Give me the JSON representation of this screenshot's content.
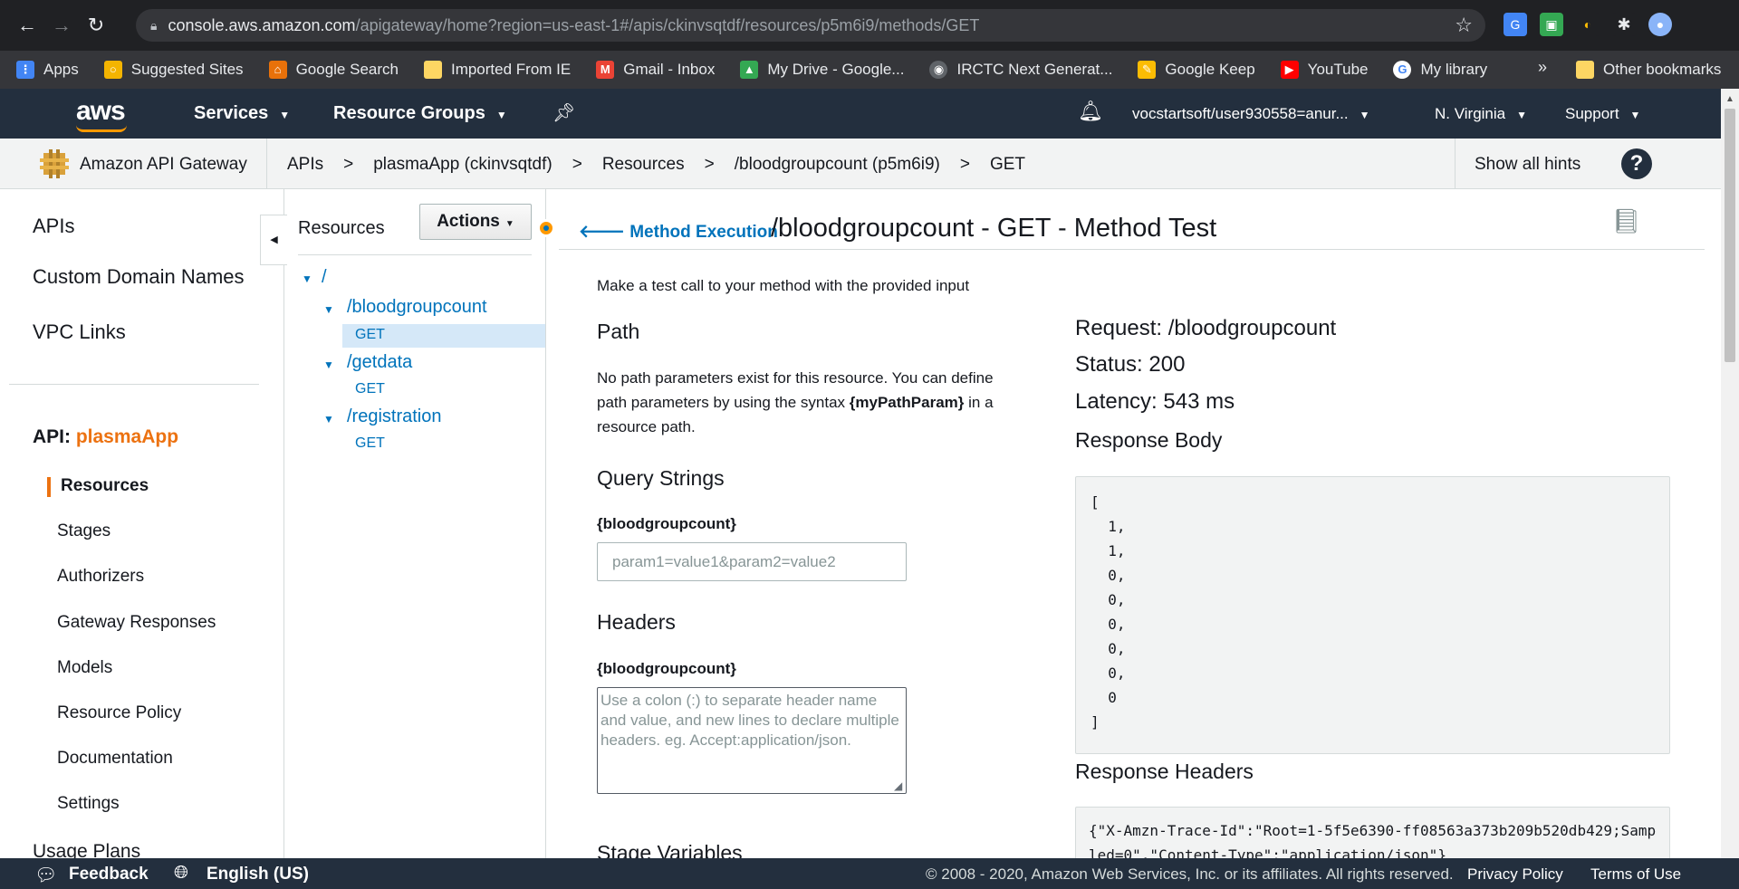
{
  "browser": {
    "url_host": "console.aws.amazon.com",
    "url_path": "/apigateway/home?region=us-east-1#/apis/ckinvsqtdf/resources/p5m6i9/methods/GET",
    "bookmarks": [
      {
        "label": "Apps",
        "icon": "apps-grid-icon",
        "color": "#4285f4"
      },
      {
        "label": "Suggested Sites",
        "icon": "suggested-sites-icon",
        "color": "#f4b400"
      },
      {
        "label": "Google Search",
        "icon": "home-icon",
        "color": "#e8710a"
      },
      {
        "label": "Imported From IE",
        "icon": "folder-icon",
        "color": "#fdd663"
      },
      {
        "label": "Gmail - Inbox",
        "icon": "gmail-icon",
        "color": "#ea4335"
      },
      {
        "label": "My Drive - Google...",
        "icon": "drive-icon",
        "color": "#34a853"
      },
      {
        "label": "IRCTC Next Generat...",
        "icon": "globe-icon",
        "color": "#5f6368"
      },
      {
        "label": "Google Keep",
        "icon": "keep-icon",
        "color": "#fbbc04"
      },
      {
        "label": "YouTube",
        "icon": "youtube-icon",
        "color": "#ff0000"
      },
      {
        "label": "My library",
        "icon": "google-icon",
        "color": "#ffffff"
      }
    ],
    "more": "»",
    "other_bookmarks": "Other bookmarks"
  },
  "aws_nav": {
    "logo": "aws",
    "services": "Services",
    "resource_groups": "Resource Groups",
    "account": "vocstartsoft/user930558=anur...",
    "region": "N. Virginia",
    "support": "Support"
  },
  "breadcrumb": {
    "service_name": "Amazon API Gateway",
    "items": [
      "APIs",
      "plasmaApp (ckinvsqtdf)",
      "Resources",
      "/bloodgroupcount (p5m6i9)",
      "GET"
    ],
    "separator": ">",
    "show_hints": "Show all hints",
    "help": "?"
  },
  "sidebar": {
    "top_links": [
      "APIs",
      "Custom Domain Names",
      "VPC Links"
    ],
    "api_prefix": "API:",
    "api_name": "plasmaApp",
    "sub_items": [
      "Resources",
      "Stages",
      "Authorizers",
      "Gateway Responses",
      "Models",
      "Resource Policy",
      "Documentation",
      "Settings"
    ],
    "bottom_link": "Usage Plans",
    "active": "Resources"
  },
  "tree": {
    "title": "Resources",
    "actions": "Actions",
    "root": "/",
    "resources": [
      {
        "path": "/bloodgroupcount",
        "methods": [
          "GET"
        ]
      },
      {
        "path": "/getdata",
        "methods": [
          "GET"
        ]
      },
      {
        "path": "/registration",
        "methods": [
          "GET"
        ]
      }
    ]
  },
  "main": {
    "back_link": "Method Execution",
    "title": "/bloodgroupcount - GET - Method Test",
    "intro": "Make a test call to your method with the provided input",
    "path_heading": "Path",
    "path_text_1": "No path parameters exist for this resource. You can define path parameters by using the syntax ",
    "path_param": "{myPathParam}",
    "path_text_2": " in a resource path.",
    "query_heading": "Query Strings",
    "query_label": "{bloodgroupcount}",
    "query_placeholder": "param1=value1&param2=value2",
    "headers_heading": "Headers",
    "headers_label": "{bloodgroupcount}",
    "headers_placeholder": "Use a colon (:) to separate header name and value, and new lines to declare multiple headers. eg. Accept:application/json.",
    "stage_vars_heading": "Stage Variables"
  },
  "response": {
    "request": "Request: /bloodgroupcount",
    "status": "Status: 200",
    "latency": "Latency: 543 ms",
    "body_heading": "Response Body",
    "body": "[\n  1,\n  1,\n  0,\n  0,\n  0,\n  0,\n  0,\n  0\n]",
    "headers_heading": "Response Headers",
    "headers": "{\"X-Amzn-Trace-Id\":\"Root=1-5f5e6390-ff08563a373b209b520db429;Sampled=0\",\"Content-Type\":\"application/json\"}"
  },
  "footer": {
    "feedback": "Feedback",
    "language": "English (US)",
    "copyright": "© 2008 - 2020, Amazon Web Services, Inc. or its affiliates. All rights reserved.",
    "privacy": "Privacy Policy",
    "terms": "Terms of Use"
  }
}
